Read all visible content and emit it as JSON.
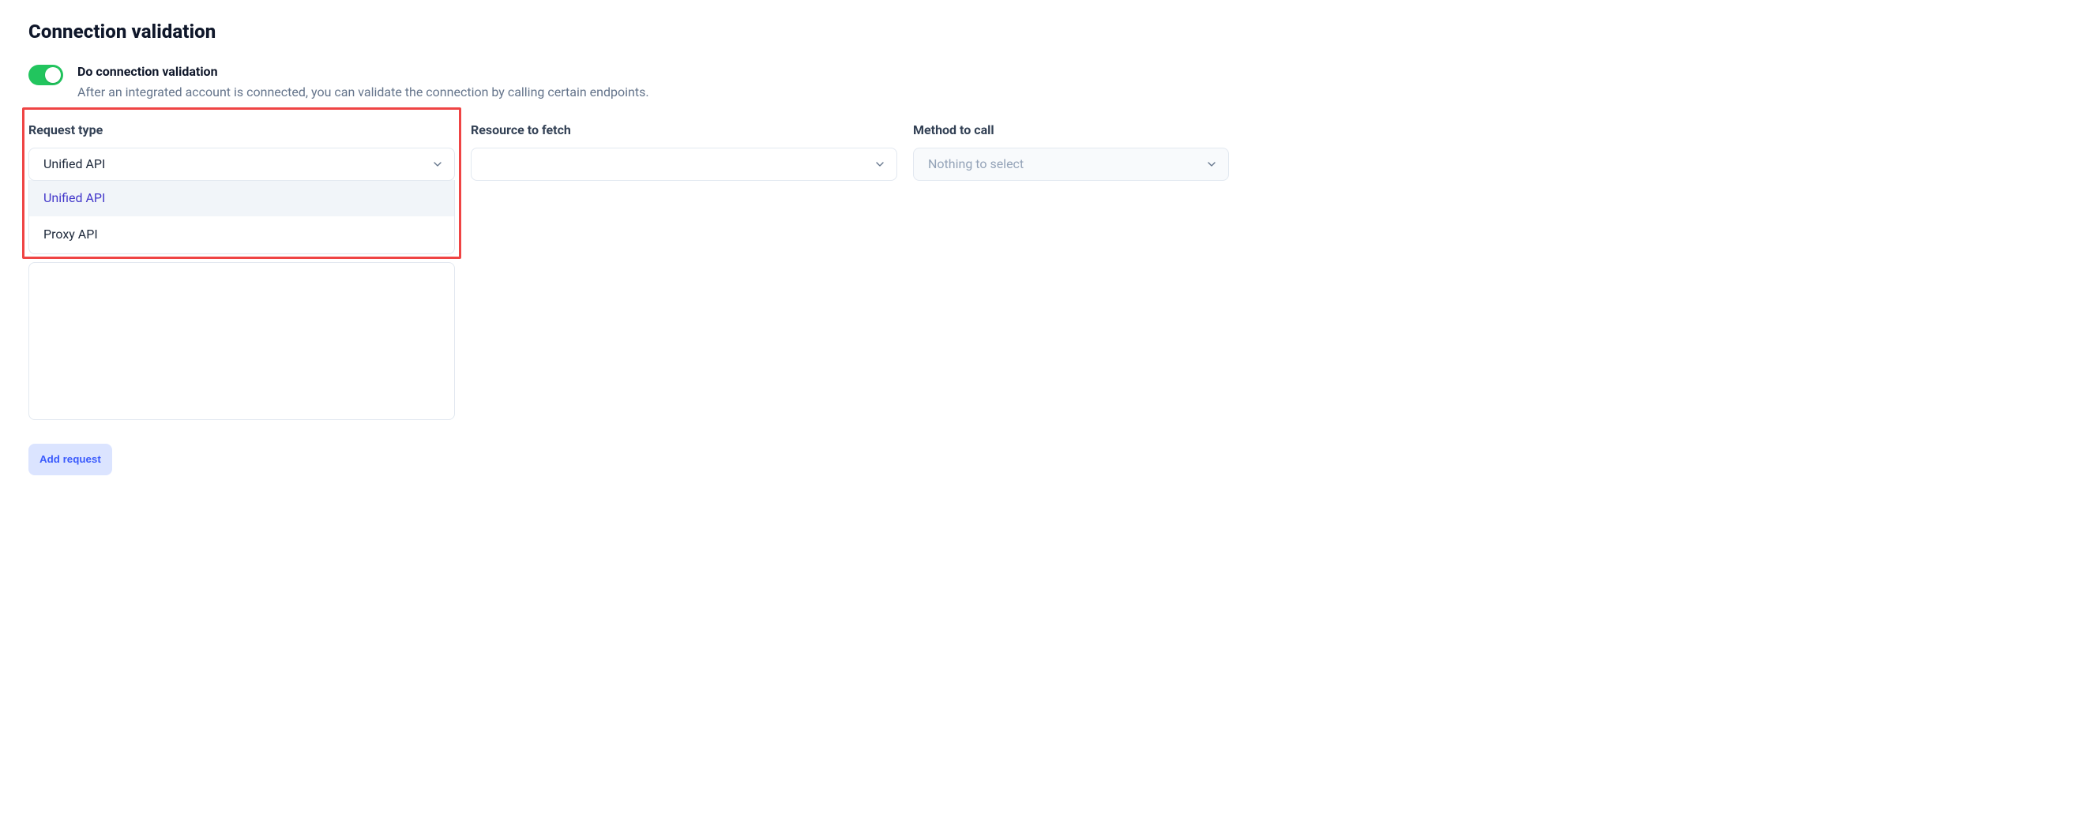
{
  "title": "Connection validation",
  "toggle": {
    "label": "Do connection validation",
    "description": "After an integrated account is connected, you can validate the connection by calling certain endpoints.",
    "on": true
  },
  "fields": {
    "request_type": {
      "label": "Request type",
      "selected": "Unified API",
      "options": [
        "Unified API",
        "Proxy API"
      ]
    },
    "resource_to_fetch": {
      "label": "Resource to fetch",
      "selected": ""
    },
    "method_to_call": {
      "label": "Method to call",
      "placeholder": "Nothing to select",
      "disabled": true
    }
  },
  "add_request_label": "Add request"
}
